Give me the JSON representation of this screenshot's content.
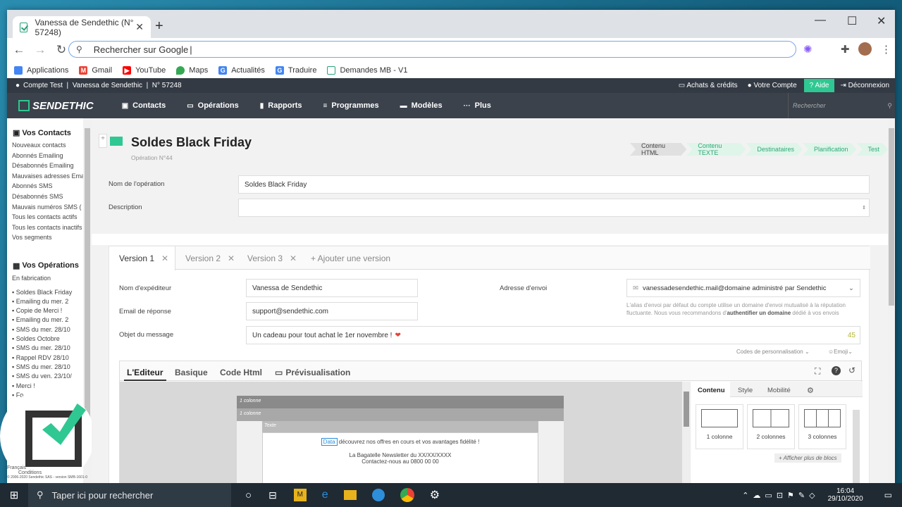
{
  "browser": {
    "tab_title": "Vanessa de Sendethic (N° 57248)",
    "omnibox": "Rechercher sur Google",
    "bookmarks": [
      {
        "label": "Applications",
        "color": "#4285f4"
      },
      {
        "label": "Gmail",
        "color": "#ea4335"
      },
      {
        "label": "YouTube",
        "color": "#ff0000"
      },
      {
        "label": "Maps",
        "color": "#34a853"
      },
      {
        "label": "Actualités",
        "color": "#4285f4"
      },
      {
        "label": "Traduire",
        "color": "#4285f4"
      },
      {
        "label": "Demandes MB - V1",
        "color": "#2aa37a"
      }
    ]
  },
  "app": {
    "account": "Compte Test  |  Vanessa de Sendethic  |  N° 57248",
    "top_links": {
      "achats": "Achats & crédits",
      "compte": "Votre Compte",
      "aide": "Aide",
      "deconnexion": "Déconnexion"
    },
    "brand": "SENDETHIC",
    "nav": [
      "Contacts",
      "Opérations",
      "Rapports",
      "Programmes",
      "Modèles",
      "Plus"
    ],
    "search_placeholder": "Rechercher",
    "accent": "#2fc892"
  },
  "sidebar": {
    "contacts_title": "Vos Contacts",
    "contacts": [
      "Nouveaux contacts",
      "Abonnés Emailing",
      "Désabonnés Emailing",
      "Mauvaises adresses Ema",
      "Abonnés SMS",
      "Désabonnés SMS",
      "Mauvais numéros SMS (",
      "Tous les contacts actifs",
      "Tous les contacts inactifs",
      "Vos segments"
    ],
    "ops_title": "Vos Opérations",
    "ops_sub": "En fabrication",
    "ops": [
      "Soldes Black Friday",
      "Emailing du mer. 2",
      "Copie de Merci !",
      "Emailing du mer. 2",
      "SMS du mer. 28/10",
      "Soldes Octobre",
      "SMS du mer. 28/10",
      "Rappel RDV 28/10",
      "SMS du mer. 28/10",
      "SMS du ven. 23/10/",
      "Merci !",
      "Fo"
    ],
    "footer_lang": "Français",
    "footer_cond": "Conditions",
    "footer_copy": "© 2006-2020 Sendethic SAS - version SMB-1601-0"
  },
  "operation": {
    "title": "Soldes Black Friday",
    "subtitle": "Opération N°44",
    "steps": [
      "Contenu HTML",
      "Contenu TEXTE",
      "Destinataires",
      "Planification",
      "Test"
    ],
    "name_label": "Nom de l'opération",
    "name_value": "Soldes Black Friday",
    "desc_label": "Description"
  },
  "versions": {
    "tabs": [
      "Version 1",
      "Version 2",
      "Version 3"
    ],
    "add": "+ Ajouter une version",
    "sender_label": "Nom d'expéditeur",
    "sender_value": "Vanessa de Sendethic",
    "reply_label": "Email de réponse",
    "reply_value": "support@sendethic.com",
    "subject_label": "Objet du message",
    "subject_value": "Un cadeau pour tout achat le 1er novembre !",
    "subject_count": "45",
    "address_label": "Adresse d'envoi",
    "address_value": "vanessadesendethic.mail@domaine administré par Sendethic",
    "address_note1": "L'alias d'envoi par défaut du compte utilise un domaine d'envoi mutualisé à la réputation",
    "address_note2a": "fluctuante. Nous vous recommandons d'",
    "address_note2b": "authentifier un domaine",
    "address_note2c": " dédié à vos envois",
    "codes": "Codes de personnalisation",
    "emoji": "Emoji"
  },
  "editor": {
    "tabs": [
      "L'Editeur",
      "Basique",
      "Code Html",
      "Prévisualisation"
    ],
    "row1": "1 colonne",
    "row2": "1 colonne",
    "texte": "Texte",
    "data_tag": "Data",
    "line1": " découvrez nos offres en cours et vos avantages fidélité !",
    "line2": "La Bagatelle Newsletter du XX/XX/XXXX",
    "line3": "Contactez-nous au 0800 00 00",
    "right_tabs": [
      "Contenu",
      "Style",
      "Mobilité"
    ],
    "blocks": [
      "1 colonne",
      "2 colonnes",
      "3 colonnes"
    ],
    "more": "+ Afficher plus de blocs"
  },
  "taskbar": {
    "search": "Taper ici pour rechercher",
    "time": "16:04",
    "date": "29/10/2020"
  }
}
